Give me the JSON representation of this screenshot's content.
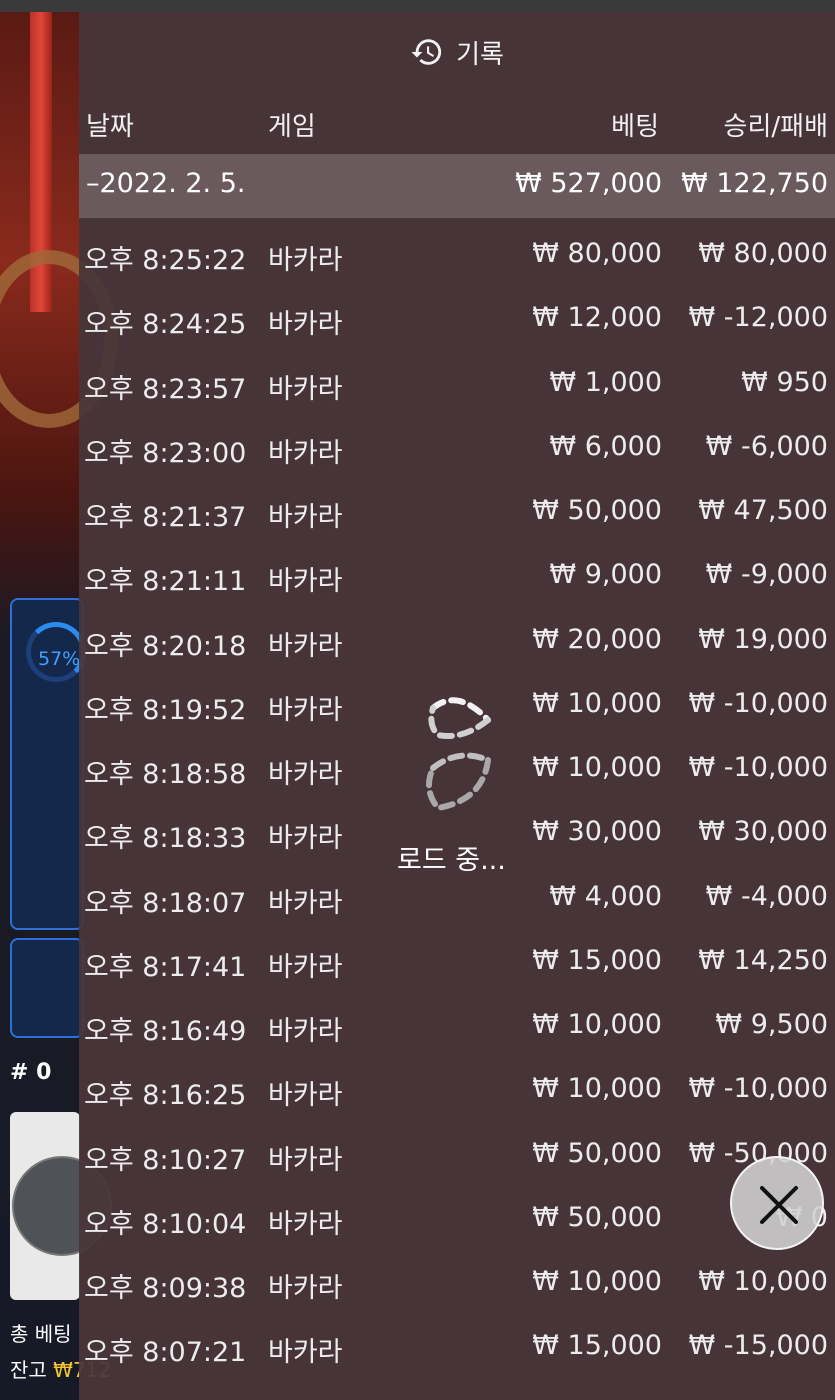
{
  "header": {
    "title": "기록",
    "icon": "history-icon"
  },
  "columns": {
    "date": "날짜",
    "game": "게임",
    "bet": "베팅",
    "win_loss": "승리/패배"
  },
  "summary": {
    "date": "–2022. 2. 5.",
    "bet": "₩ 527,000",
    "win_loss": "₩ 122,750"
  },
  "rows": [
    {
      "time": "오후 8:25:22",
      "game": "바카라",
      "bet": "₩ 80,000",
      "win_loss": "₩ 80,000"
    },
    {
      "time": "오후 8:24:25",
      "game": "바카라",
      "bet": "₩ 12,000",
      "win_loss": "₩ -12,000"
    },
    {
      "time": "오후 8:23:57",
      "game": "바카라",
      "bet": "₩ 1,000",
      "win_loss": "₩ 950"
    },
    {
      "time": "오후 8:23:00",
      "game": "바카라",
      "bet": "₩ 6,000",
      "win_loss": "₩ -6,000"
    },
    {
      "time": "오후 8:21:37",
      "game": "바카라",
      "bet": "₩ 50,000",
      "win_loss": "₩ 47,500"
    },
    {
      "time": "오후 8:21:11",
      "game": "바카라",
      "bet": "₩ 9,000",
      "win_loss": "₩ -9,000"
    },
    {
      "time": "오후 8:20:18",
      "game": "바카라",
      "bet": "₩ 20,000",
      "win_loss": "₩ 19,000"
    },
    {
      "time": "오후 8:19:52",
      "game": "바카라",
      "bet": "₩ 10,000",
      "win_loss": "₩ -10,000"
    },
    {
      "time": "오후 8:18:58",
      "game": "바카라",
      "bet": "₩ 10,000",
      "win_loss": "₩ -10,000"
    },
    {
      "time": "오후 8:18:33",
      "game": "바카라",
      "bet": "₩ 30,000",
      "win_loss": "₩ 30,000"
    },
    {
      "time": "오후 8:18:07",
      "game": "바카라",
      "bet": "₩ 4,000",
      "win_loss": "₩ -4,000"
    },
    {
      "time": "오후 8:17:41",
      "game": "바카라",
      "bet": "₩ 15,000",
      "win_loss": "₩ 14,250"
    },
    {
      "time": "오후 8:16:49",
      "game": "바카라",
      "bet": "₩ 10,000",
      "win_loss": "₩ 9,500"
    },
    {
      "time": "오후 8:16:25",
      "game": "바카라",
      "bet": "₩ 10,000",
      "win_loss": "₩ -10,000"
    },
    {
      "time": "오후 8:10:27",
      "game": "바카라",
      "bet": "₩ 50,000",
      "win_loss": "₩ -50,000"
    },
    {
      "time": "오후 8:10:04",
      "game": "바카라",
      "bet": "₩ 50,000",
      "win_loss": "₩ 0"
    },
    {
      "time": "오후 8:09:38",
      "game": "바카라",
      "bet": "₩ 10,000",
      "win_loss": "₩ 10,000"
    },
    {
      "time": "오후 8:07:21",
      "game": "바카라",
      "bet": "₩ 15,000",
      "win_loss": "₩ -15,000"
    }
  ],
  "loading": {
    "text": "로드 중..."
  },
  "background": {
    "percent": "57%",
    "counter": "# 0",
    "total_bet_label": "총 베팅",
    "balance_label": "잔고",
    "balance_value": "₩712"
  },
  "colors": {
    "panel": "#48363a",
    "summary_row": "#6a5a5d",
    "accent_blue": "#2f6fd8",
    "balance_yellow": "#f2c534"
  }
}
